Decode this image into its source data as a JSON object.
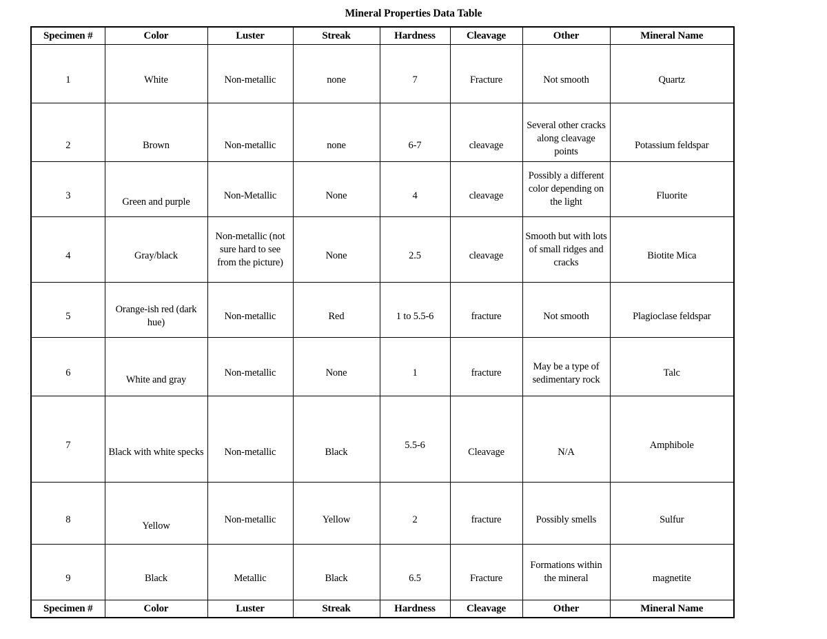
{
  "document": {
    "title": "Mineral Properties Data Table"
  },
  "table": {
    "columns": [
      {
        "key": "specimen",
        "label": "Specimen #"
      },
      {
        "key": "color",
        "label": "Color"
      },
      {
        "key": "luster",
        "label": "Luster"
      },
      {
        "key": "streak",
        "label": "Streak"
      },
      {
        "key": "hardness",
        "label": "Hardness"
      },
      {
        "key": "cleavage",
        "label": "Cleavage"
      },
      {
        "key": "other",
        "label": "Other"
      },
      {
        "key": "mineral_name",
        "label": "Mineral Name"
      }
    ],
    "rows": [
      {
        "specimen": "1",
        "color": "White",
        "luster": "Non-metallic",
        "streak": "none",
        "hardness": "7",
        "cleavage": "Fracture",
        "other": "Not smooth",
        "mineral_name": "Quartz"
      },
      {
        "specimen": "2",
        "color": "Brown",
        "luster": "Non-metallic",
        "streak": "none",
        "hardness": "6-7",
        "cleavage": "cleavage",
        "other": "Several other cracks along cleavage points",
        "mineral_name": "Potassium feldspar"
      },
      {
        "specimen": "3",
        "color": "Green and purple",
        "luster": "Non-Metallic",
        "streak": "None",
        "hardness": "4",
        "cleavage": "cleavage",
        "other": "Possibly a different color depending on the light",
        "mineral_name": "Fluorite"
      },
      {
        "specimen": "4",
        "color": "Gray/black",
        "luster": "Non-metallic (not sure hard to see from the picture)",
        "streak": "None",
        "hardness": "2.5",
        "cleavage": "cleavage",
        "other": "Smooth but with lots of small ridges and cracks",
        "mineral_name": "Biotite Mica"
      },
      {
        "specimen": "5",
        "color": "Orange-ish red (dark hue)",
        "luster": "Non-metallic",
        "streak": "Red",
        "hardness": "1 to 5.5-6",
        "cleavage": "fracture",
        "other": "Not smooth",
        "mineral_name": "Plagioclase feldspar"
      },
      {
        "specimen": "6",
        "color": "White and gray",
        "luster": "Non-metallic",
        "streak": "None",
        "hardness": "1",
        "cleavage": "fracture",
        "other": "May be a type of sedimentary rock",
        "mineral_name": "Talc"
      },
      {
        "specimen": "7",
        "color": "Black with white specks",
        "luster": "Non-metallic",
        "streak": "Black",
        "hardness": "5.5-6",
        "cleavage": "Cleavage",
        "other": "N/A",
        "mineral_name": "Amphibole"
      },
      {
        "specimen": "8",
        "color": "Yellow",
        "luster": "Non-metallic",
        "streak": "Yellow",
        "hardness": "2",
        "cleavage": "fracture",
        "other": "Possibly smells",
        "mineral_name": "Sulfur"
      },
      {
        "specimen": "9",
        "color": "Black",
        "luster": "Metallic",
        "streak": "Black",
        "hardness": "6.5",
        "cleavage": "Fracture",
        "other": "Formations within the mineral",
        "mineral_name": "magnetite"
      }
    ],
    "footer_columns": [
      {
        "key": "specimen",
        "label": "Specimen #"
      },
      {
        "key": "color",
        "label": "Color"
      },
      {
        "key": "luster",
        "label": "Luster"
      },
      {
        "key": "streak",
        "label": "Streak"
      },
      {
        "key": "hardness",
        "label": "Hardness"
      },
      {
        "key": "cleavage",
        "label": "Cleavage"
      },
      {
        "key": "other",
        "label": "Other"
      },
      {
        "key": "mineral_name",
        "label": "Mineral Name"
      }
    ]
  }
}
